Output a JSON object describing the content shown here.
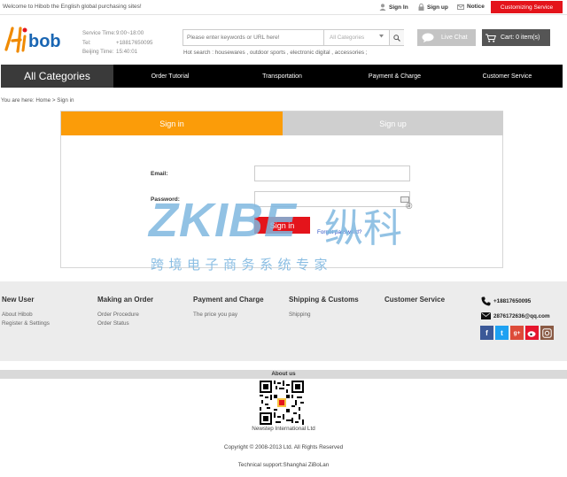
{
  "topbar": {
    "welcome": "Welcome to Hibob the English global purchasing sites!",
    "sign_in": "Sign In",
    "sign_up": "Sign up",
    "notice": "Notice",
    "customizing": "Customizing Service"
  },
  "header": {
    "logo_text": "bob",
    "service": [
      {
        "key": "Service Time:",
        "value": "9:00~18:00"
      },
      {
        "key": "Tel:",
        "value": "+18817650095"
      },
      {
        "key": "Beijing Time:",
        "value": "15:40:01"
      }
    ],
    "search_placeholder": "Please enter keywords or URL here!",
    "categories_select": "All Categories",
    "hot_search": "Hot search : housewares , outdoor sports , electronic digital , accessories ;",
    "live_chat": "Live Chat",
    "cart": "Cart: 0 item(s)"
  },
  "nav": {
    "all_categories": "All Categories",
    "items": [
      "Order Tutorial",
      "Transportation",
      "Payment & Charge",
      "Customer Service"
    ]
  },
  "breadcrumb": "You are here: Home > Sign in",
  "login": {
    "tab_signin": "Sign in",
    "tab_signup": "Sign up",
    "email_label": "Email:",
    "email_value": "",
    "password_label": "Password:",
    "password_value": "",
    "signin_button": "Sign in",
    "forgot": "Forgot password?"
  },
  "watermark": {
    "brand": "ZKIBE",
    "brand_cn": "纵科",
    "tagline": "跨境电子商务系统专家"
  },
  "footer": {
    "columns": [
      {
        "title": "New User",
        "links": [
          "About Hibob",
          "Register & Settings"
        ]
      },
      {
        "title": "Making an Order",
        "links": [
          "Order Procedure",
          "Order Status"
        ]
      },
      {
        "title": "Payment and Charge",
        "links": [
          "The price you pay"
        ]
      },
      {
        "title": "Shipping & Customs",
        "links": [
          "Shipping"
        ]
      },
      {
        "title": "Customer Service",
        "links": []
      }
    ],
    "phone": "+18817650095",
    "email": "2876172636@qq.com",
    "social": [
      "facebook-icon",
      "twitter-icon",
      "google-plus-icon",
      "weibo-icon",
      "instagram-icon"
    ]
  },
  "bottom": {
    "about_us": "About us",
    "company": "Newstep International Ltd",
    "copyright": "Copyright © 2008-2013 Ltd. All Rights Reserved",
    "support": "Technical support:Shanghai ZiBoLan"
  },
  "colors": {
    "accent_red": "#e4141b",
    "accent_orange": "#fb9c09",
    "watermark_blue": "#7fb8e0"
  }
}
